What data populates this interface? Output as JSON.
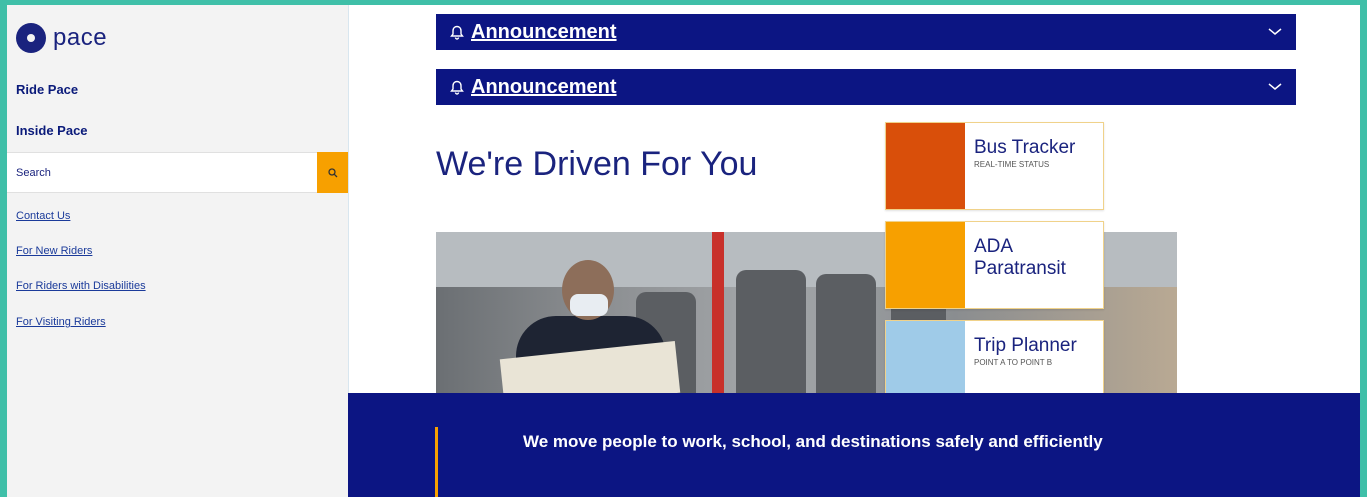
{
  "sidebar": {
    "logo_text": "pace",
    "nav_main": [
      "Ride Pace",
      "Inside Pace"
    ],
    "search": {
      "placeholder": "Search",
      "icon": "search-icon"
    },
    "links": [
      "Contact Us",
      "For New Riders",
      "For Riders with Disabilities",
      "For Visiting Riders"
    ]
  },
  "announcements": [
    {
      "label": "Announcement",
      "icon": "bell-icon"
    },
    {
      "label": "Announcement",
      "icon": "bell-icon"
    }
  ],
  "hero": {
    "title": "We're Driven For You"
  },
  "tiles": [
    {
      "title": "Bus Tracker",
      "subtitle": "REAL-TIME STATUS",
      "color": "#d94f0a"
    },
    {
      "title": "ADA Paratransit",
      "subtitle": "",
      "color": "#f7a000"
    },
    {
      "title": "Trip Planner",
      "subtitle": "POINT A TO POINT B",
      "color": "#9fcbe8"
    }
  ],
  "mission": {
    "text": "We move people to work, school, and destinations safely and efficiently"
  },
  "colors": {
    "brand_navy": "#0c1583",
    "accent_orange": "#f7a000",
    "frame_teal": "#3fbfa8"
  }
}
